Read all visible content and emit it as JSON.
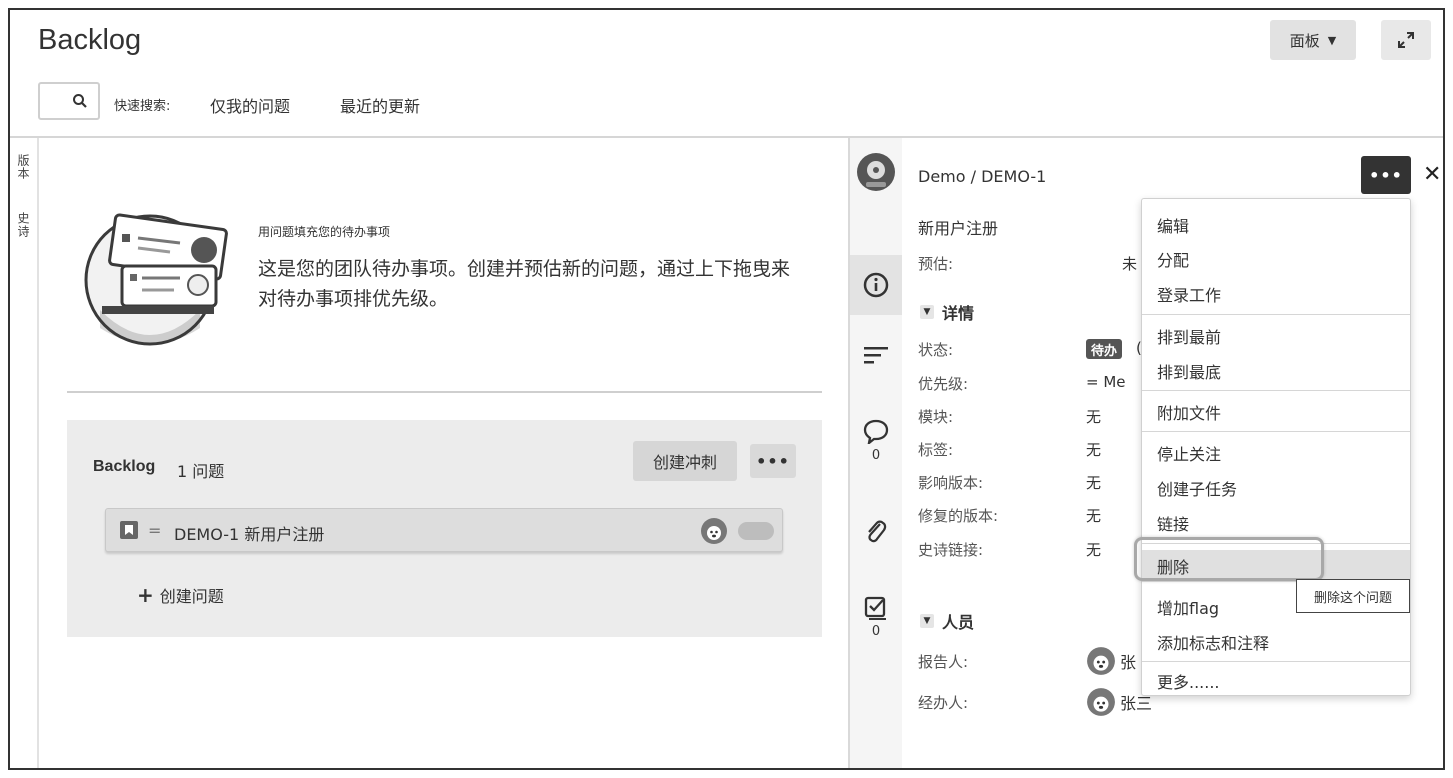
{
  "header": {
    "title": "Backlog",
    "board_button": "面板",
    "quick_search_label": "快速搜索:",
    "quick_filters": [
      "仅我的问题",
      "最近的更新"
    ]
  },
  "left_rail": [
    "版本",
    "史诗"
  ],
  "empty_state": {
    "heading": "用问题填充您的待办事项",
    "description": "这是您的团队待办事项。创建并预估新的问题，通过上下拖曳来对待办事项排优先级。"
  },
  "backlog": {
    "title": "Backlog",
    "count": "1 问题",
    "create_sprint": "创建冲刺",
    "more": "•••",
    "issue": "DEMO-1 新用户注册",
    "create_issue": "创建问题"
  },
  "detail": {
    "breadcrumb": "Demo / DEMO-1",
    "more": "•••",
    "summary": "新用户注册",
    "estimate_label": "预估:",
    "estimate_value": "未",
    "details_title": "详情",
    "fields": [
      {
        "label": "状态:",
        "value": ""
      },
      {
        "label": "优先级:",
        "value": ""
      },
      {
        "label": "模块:",
        "value": "无"
      },
      {
        "label": "标签:",
        "value": "无"
      },
      {
        "label": "影响版本:",
        "value": "无"
      },
      {
        "label": "修复的版本:",
        "value": "无"
      },
      {
        "label": "史诗链接:",
        "value": "无"
      }
    ],
    "status_badge": "待办",
    "status_after": "(",
    "priority_value": "Me",
    "people_title": "人员",
    "reporter_label": "报告人:",
    "reporter_value": "张",
    "assignee_label": "经办人:",
    "assignee_value": "张三",
    "strip_counts": [
      "0",
      "0"
    ]
  },
  "menu": {
    "items": [
      "编辑",
      "分配",
      "登录工作",
      "排到最前",
      "排到最底",
      "附加文件",
      "停止关注",
      "创建子任务",
      "链接",
      "删除",
      "增加flag",
      "添加标志和注释",
      "更多......"
    ],
    "highlighted": "删除",
    "tooltip": "删除这个问题"
  },
  "colors": {
    "menu_hover": "#e0e0e0",
    "dark_button": "#333333",
    "status_badge": "#555555"
  }
}
